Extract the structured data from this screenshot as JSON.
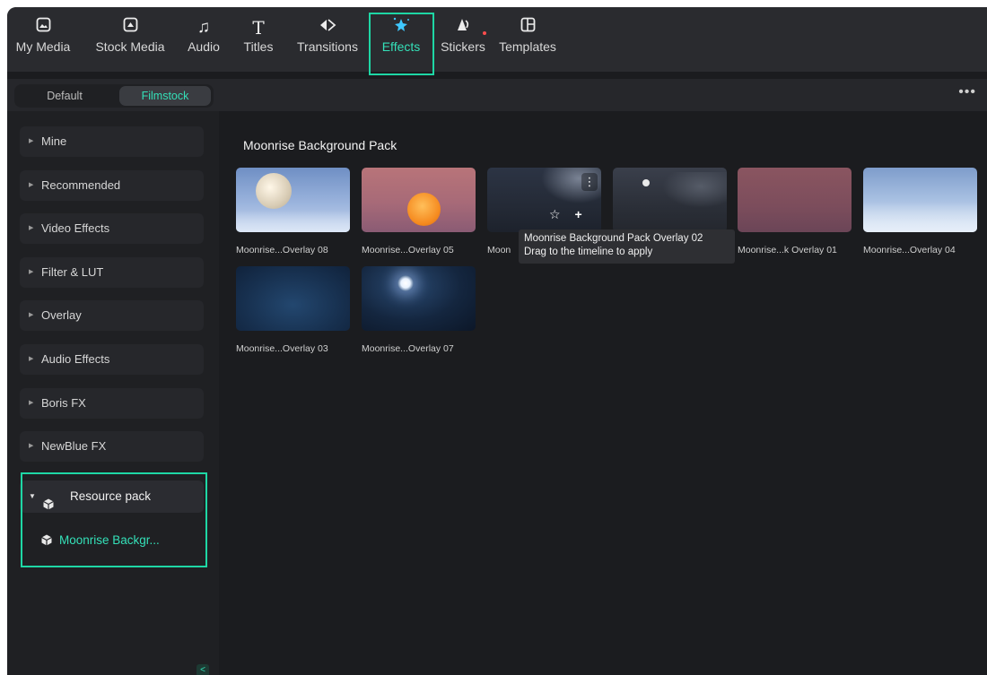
{
  "toolbar": {
    "tabs": [
      {
        "label": "My Media",
        "icon": "image-icon"
      },
      {
        "label": "Stock Media",
        "icon": "folder-icon"
      },
      {
        "label": "Audio",
        "icon": "music-note-icon"
      },
      {
        "label": "Titles",
        "icon": "text-icon"
      },
      {
        "label": "Transitions",
        "icon": "transition-icon"
      },
      {
        "label": "Effects",
        "icon": "sparkle-icon"
      },
      {
        "label": "Stickers",
        "icon": "sticker-icon"
      },
      {
        "label": "Templates",
        "icon": "templates-icon"
      }
    ],
    "active_tab": "Effects",
    "accent_color": "#1ed7a5"
  },
  "subbar": {
    "segments": [
      "Default",
      "Filmstock"
    ],
    "active_segment": "Filmstock",
    "more": "•••"
  },
  "sidebar": {
    "categories": [
      "Mine",
      "Recommended",
      "Video Effects",
      "Filter & LUT",
      "Overlay",
      "Audio Effects",
      "Boris FX",
      "NewBlue FX"
    ],
    "resource_pack": {
      "label": "Resource pack",
      "item": "Moonrise Backgr..."
    },
    "collapse": "<"
  },
  "main": {
    "section_title": "Moonrise Background Pack",
    "items": [
      {
        "caption": "Moonrise...Overlay 08",
        "palette": "blue-sky-full-moon"
      },
      {
        "caption": "Moonrise...Overlay 05",
        "palette": "pink-orange-moon"
      },
      {
        "caption": "Moon",
        "palette": "dark-cloudy"
      },
      {
        "caption": "",
        "palette": "dark-small-moon"
      },
      {
        "caption": "Moonrise...k Overlay 01",
        "palette": "dusky-rose"
      },
      {
        "caption": "Moonrise...Overlay 04",
        "palette": "pale-blue-sky"
      },
      {
        "caption": "Moonrise...Overlay 03",
        "palette": "dark-blue-night"
      },
      {
        "caption": "Moonrise...Overlay 07",
        "palette": "night-glowing-moon"
      }
    ],
    "tooltip": {
      "line1": "Moonrise Background Pack Overlay 02",
      "line2": "Drag to the timeline to apply"
    }
  }
}
